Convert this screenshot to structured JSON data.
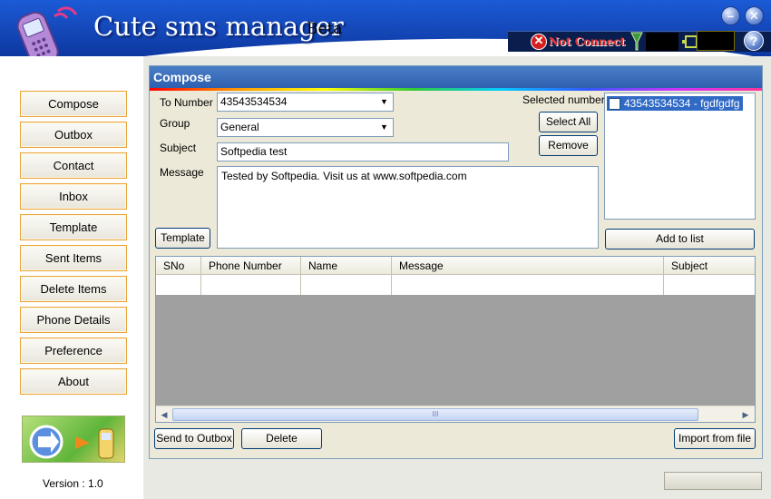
{
  "app": {
    "title": "Cute sms manager",
    "subtitle": "Beta",
    "connection_status": "Not Connect",
    "version": "Version : 1.0"
  },
  "nav": [
    {
      "label": "Compose"
    },
    {
      "label": "Outbox"
    },
    {
      "label": "Contact"
    },
    {
      "label": "Inbox"
    },
    {
      "label": "Template"
    },
    {
      "label": "Sent Items"
    },
    {
      "label": "Delete Items"
    },
    {
      "label": "Phone Details"
    },
    {
      "label": "Preference"
    },
    {
      "label": "About"
    }
  ],
  "compose": {
    "panel_title": "Compose",
    "to_number_label": "To Number",
    "to_number_value": "43543534534",
    "group_label": "Group",
    "group_value": "General",
    "subject_label": "Subject",
    "subject_value": "Softpedia test",
    "message_label": "Message",
    "message_value": "Tested by Softpedia. Visit us at www.softpedia.com",
    "selected_numbers_label": "Selected numbers",
    "selected_numbers": [
      "43543534534 - fgdfgdfg"
    ],
    "buttons": {
      "select_all": "Select All",
      "remove": "Remove",
      "template": "Template",
      "add_to_list": "Add to list",
      "send_to_outbox": "Send to Outbox",
      "delete": "Delete",
      "import_from_file": "Import from file"
    }
  },
  "grid": {
    "columns": [
      "SNo",
      "Phone Number",
      "Name",
      "Message",
      "Subject"
    ],
    "scroll_thumb": "III"
  },
  "colors": {
    "header_blue": "#1447b8",
    "nav_border": "#e8a338",
    "panel_title": "#2e5fb0",
    "selection": "#316ac5",
    "not_connect": "#e03030"
  },
  "icons": {
    "minimize": "minimize-icon",
    "close": "close-icon",
    "help": "help-icon"
  }
}
